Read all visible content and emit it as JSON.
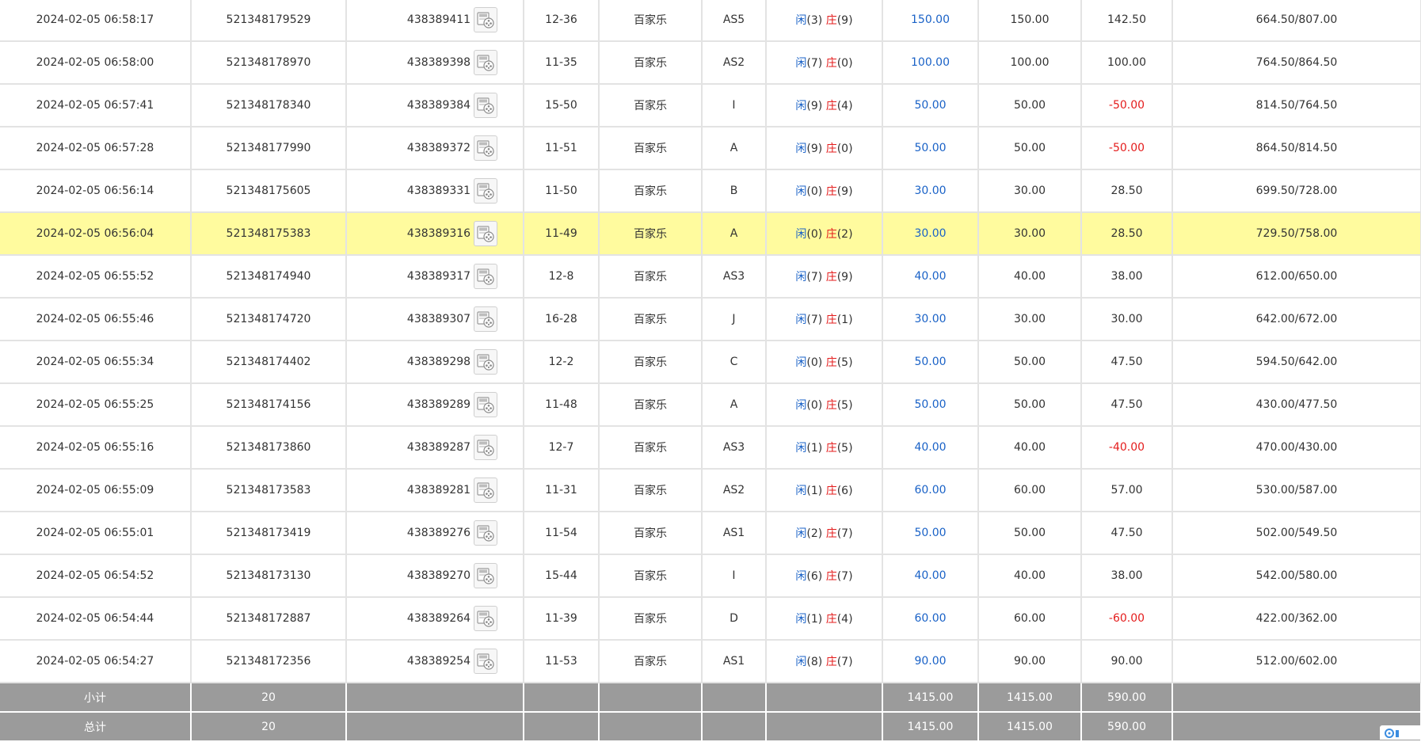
{
  "rows": [
    {
      "time": "2024-02-05 06:58:17",
      "bet_no": "521348179529",
      "round_no": "438389411",
      "shoe": "12-36",
      "game": "百家乐",
      "table": "AS5",
      "p_label": "闲",
      "p_val": "(3)",
      "b_label": "庄",
      "b_val": "(9)",
      "bet": "150.00",
      "valid": "150.00",
      "win": "142.50",
      "win_negative": false,
      "balance": "664.50/807.00",
      "highlight": false
    },
    {
      "time": "2024-02-05 06:58:00",
      "bet_no": "521348178970",
      "round_no": "438389398",
      "shoe": "11-35",
      "game": "百家乐",
      "table": "AS2",
      "p_label": "闲",
      "p_val": "(7)",
      "b_label": "庄",
      "b_val": "(0)",
      "bet": "100.00",
      "valid": "100.00",
      "win": "100.00",
      "win_negative": false,
      "balance": "764.50/864.50",
      "highlight": false
    },
    {
      "time": "2024-02-05 06:57:41",
      "bet_no": "521348178340",
      "round_no": "438389384",
      "shoe": "15-50",
      "game": "百家乐",
      "table": "I",
      "p_label": "闲",
      "p_val": "(9)",
      "b_label": "庄",
      "b_val": "(4)",
      "bet": "50.00",
      "valid": "50.00",
      "win": "-50.00",
      "win_negative": true,
      "balance": "814.50/764.50",
      "highlight": false
    },
    {
      "time": "2024-02-05 06:57:28",
      "bet_no": "521348177990",
      "round_no": "438389372",
      "shoe": "11-51",
      "game": "百家乐",
      "table": "A",
      "p_label": "闲",
      "p_val": "(9)",
      "b_label": "庄",
      "b_val": "(0)",
      "bet": "50.00",
      "valid": "50.00",
      "win": "-50.00",
      "win_negative": true,
      "balance": "864.50/814.50",
      "highlight": false
    },
    {
      "time": "2024-02-05 06:56:14",
      "bet_no": "521348175605",
      "round_no": "438389331",
      "shoe": "11-50",
      "game": "百家乐",
      "table": "B",
      "p_label": "闲",
      "p_val": "(0)",
      "b_label": "庄",
      "b_val": "(9)",
      "bet": "30.00",
      "valid": "30.00",
      "win": "28.50",
      "win_negative": false,
      "balance": "699.50/728.00",
      "highlight": false
    },
    {
      "time": "2024-02-05 06:56:04",
      "bet_no": "521348175383",
      "round_no": "438389316",
      "shoe": "11-49",
      "game": "百家乐",
      "table": "A",
      "p_label": "闲",
      "p_val": "(0)",
      "b_label": "庄",
      "b_val": "(2)",
      "bet": "30.00",
      "valid": "30.00",
      "win": "28.50",
      "win_negative": false,
      "balance": "729.50/758.00",
      "highlight": true
    },
    {
      "time": "2024-02-05 06:55:52",
      "bet_no": "521348174940",
      "round_no": "438389317",
      "shoe": "12-8",
      "game": "百家乐",
      "table": "AS3",
      "p_label": "闲",
      "p_val": "(7)",
      "b_label": "庄",
      "b_val": "(9)",
      "bet": "40.00",
      "valid": "40.00",
      "win": "38.00",
      "win_negative": false,
      "balance": "612.00/650.00",
      "highlight": false
    },
    {
      "time": "2024-02-05 06:55:46",
      "bet_no": "521348174720",
      "round_no": "438389307",
      "shoe": "16-28",
      "game": "百家乐",
      "table": "J",
      "p_label": "闲",
      "p_val": "(7)",
      "b_label": "庄",
      "b_val": "(1)",
      "bet": "30.00",
      "valid": "30.00",
      "win": "30.00",
      "win_negative": false,
      "balance": "642.00/672.00",
      "highlight": false
    },
    {
      "time": "2024-02-05 06:55:34",
      "bet_no": "521348174402",
      "round_no": "438389298",
      "shoe": "12-2",
      "game": "百家乐",
      "table": "C",
      "p_label": "闲",
      "p_val": "(0)",
      "b_label": "庄",
      "b_val": "(5)",
      "bet": "50.00",
      "valid": "50.00",
      "win": "47.50",
      "win_negative": false,
      "balance": "594.50/642.00",
      "highlight": false
    },
    {
      "time": "2024-02-05 06:55:25",
      "bet_no": "521348174156",
      "round_no": "438389289",
      "shoe": "11-48",
      "game": "百家乐",
      "table": "A",
      "p_label": "闲",
      "p_val": "(0)",
      "b_label": "庄",
      "b_val": "(5)",
      "bet": "50.00",
      "valid": "50.00",
      "win": "47.50",
      "win_negative": false,
      "balance": "430.00/477.50",
      "highlight": false
    },
    {
      "time": "2024-02-05 06:55:16",
      "bet_no": "521348173860",
      "round_no": "438389287",
      "shoe": "12-7",
      "game": "百家乐",
      "table": "AS3",
      "p_label": "闲",
      "p_val": "(1)",
      "b_label": "庄",
      "b_val": "(5)",
      "bet": "40.00",
      "valid": "40.00",
      "win": "-40.00",
      "win_negative": true,
      "balance": "470.00/430.00",
      "highlight": false
    },
    {
      "time": "2024-02-05 06:55:09",
      "bet_no": "521348173583",
      "round_no": "438389281",
      "shoe": "11-31",
      "game": "百家乐",
      "table": "AS2",
      "p_label": "闲",
      "p_val": "(1)",
      "b_label": "庄",
      "b_val": "(6)",
      "bet": "60.00",
      "valid": "60.00",
      "win": "57.00",
      "win_negative": false,
      "balance": "530.00/587.00",
      "highlight": false
    },
    {
      "time": "2024-02-05 06:55:01",
      "bet_no": "521348173419",
      "round_no": "438389276",
      "shoe": "11-54",
      "game": "百家乐",
      "table": "AS1",
      "p_label": "闲",
      "p_val": "(2)",
      "b_label": "庄",
      "b_val": "(7)",
      "bet": "50.00",
      "valid": "50.00",
      "win": "47.50",
      "win_negative": false,
      "balance": "502.00/549.50",
      "highlight": false
    },
    {
      "time": "2024-02-05 06:54:52",
      "bet_no": "521348173130",
      "round_no": "438389270",
      "shoe": "15-44",
      "game": "百家乐",
      "table": "I",
      "p_label": "闲",
      "p_val": "(6)",
      "b_label": "庄",
      "b_val": "(7)",
      "bet": "40.00",
      "valid": "40.00",
      "win": "38.00",
      "win_negative": false,
      "balance": "542.00/580.00",
      "highlight": false
    },
    {
      "time": "2024-02-05 06:54:44",
      "bet_no": "521348172887",
      "round_no": "438389264",
      "shoe": "11-39",
      "game": "百家乐",
      "table": "D",
      "p_label": "闲",
      "p_val": "(1)",
      "b_label": "庄",
      "b_val": "(4)",
      "bet": "60.00",
      "valid": "60.00",
      "win": "-60.00",
      "win_negative": true,
      "balance": "422.00/362.00",
      "highlight": false
    },
    {
      "time": "2024-02-05 06:54:27",
      "bet_no": "521348172356",
      "round_no": "438389254",
      "shoe": "11-53",
      "game": "百家乐",
      "table": "AS1",
      "p_label": "闲",
      "p_val": "(8)",
      "b_label": "庄",
      "b_val": "(7)",
      "bet": "90.00",
      "valid": "90.00",
      "win": "90.00",
      "win_negative": false,
      "balance": "512.00/602.00",
      "highlight": false
    }
  ],
  "subtotal": {
    "label": "小计",
    "count": "20",
    "bet": "1415.00",
    "valid": "1415.00",
    "win": "590.00"
  },
  "total": {
    "label": "总计",
    "count": "20",
    "bet": "1415.00",
    "valid": "1415.00",
    "win": "590.00"
  },
  "icons": {
    "replay": "replay-video-icon",
    "corner": "chat-widget-icon"
  },
  "colors": {
    "highlight_row": "#fffb9e",
    "player_blue": "#1a62c7",
    "banker_red": "#e41c1c",
    "summary_bg": "#9b9b9b"
  }
}
